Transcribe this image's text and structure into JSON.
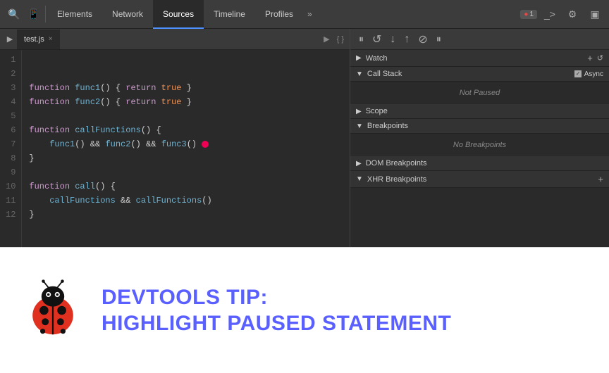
{
  "toolbar": {
    "tabs": [
      "Elements",
      "Network",
      "Sources",
      "Timeline",
      "Profiles"
    ],
    "active_tab": "Sources",
    "badge_label": "1",
    "more_label": "»"
  },
  "file_tab": {
    "name": "test.js",
    "close": "×"
  },
  "debug_controls": {
    "pause": "⏸",
    "step_over": "↺",
    "step_into": "↓",
    "step_out": "↑",
    "deactivate": "⊘",
    "pause_on_exception": "⏸"
  },
  "panels": {
    "watch": {
      "label": "Watch",
      "add_label": "+",
      "refresh_label": "↺",
      "expanded": false
    },
    "call_stack": {
      "label": "Call Stack",
      "async_label": "Async",
      "expanded": true,
      "status": "Not Paused"
    },
    "scope": {
      "label": "Scope",
      "expanded": false
    },
    "breakpoints": {
      "label": "Breakpoints",
      "expanded": true,
      "status": "No Breakpoints"
    },
    "dom_breakpoints": {
      "label": "DOM Breakpoints",
      "expanded": false
    },
    "xhr_breakpoints": {
      "label": "XHR Breakpoints",
      "expanded": false
    }
  },
  "code": {
    "lines": [
      "",
      "function func1() { return true }",
      "function func2() { return true }",
      "",
      "function callFunctions() {",
      "    func1() && func2() && func3()",
      "}",
      "",
      "function call() {",
      "    callFunctions && callFunctions()",
      "}"
    ],
    "line_numbers": [
      "1",
      "2",
      "3",
      "4",
      "5",
      "6",
      "7",
      "8",
      "9",
      "10",
      "11",
      "12"
    ]
  },
  "tip": {
    "title_line1": "DevTools Tip:",
    "title_line2": "Highlight Paused Statement"
  }
}
